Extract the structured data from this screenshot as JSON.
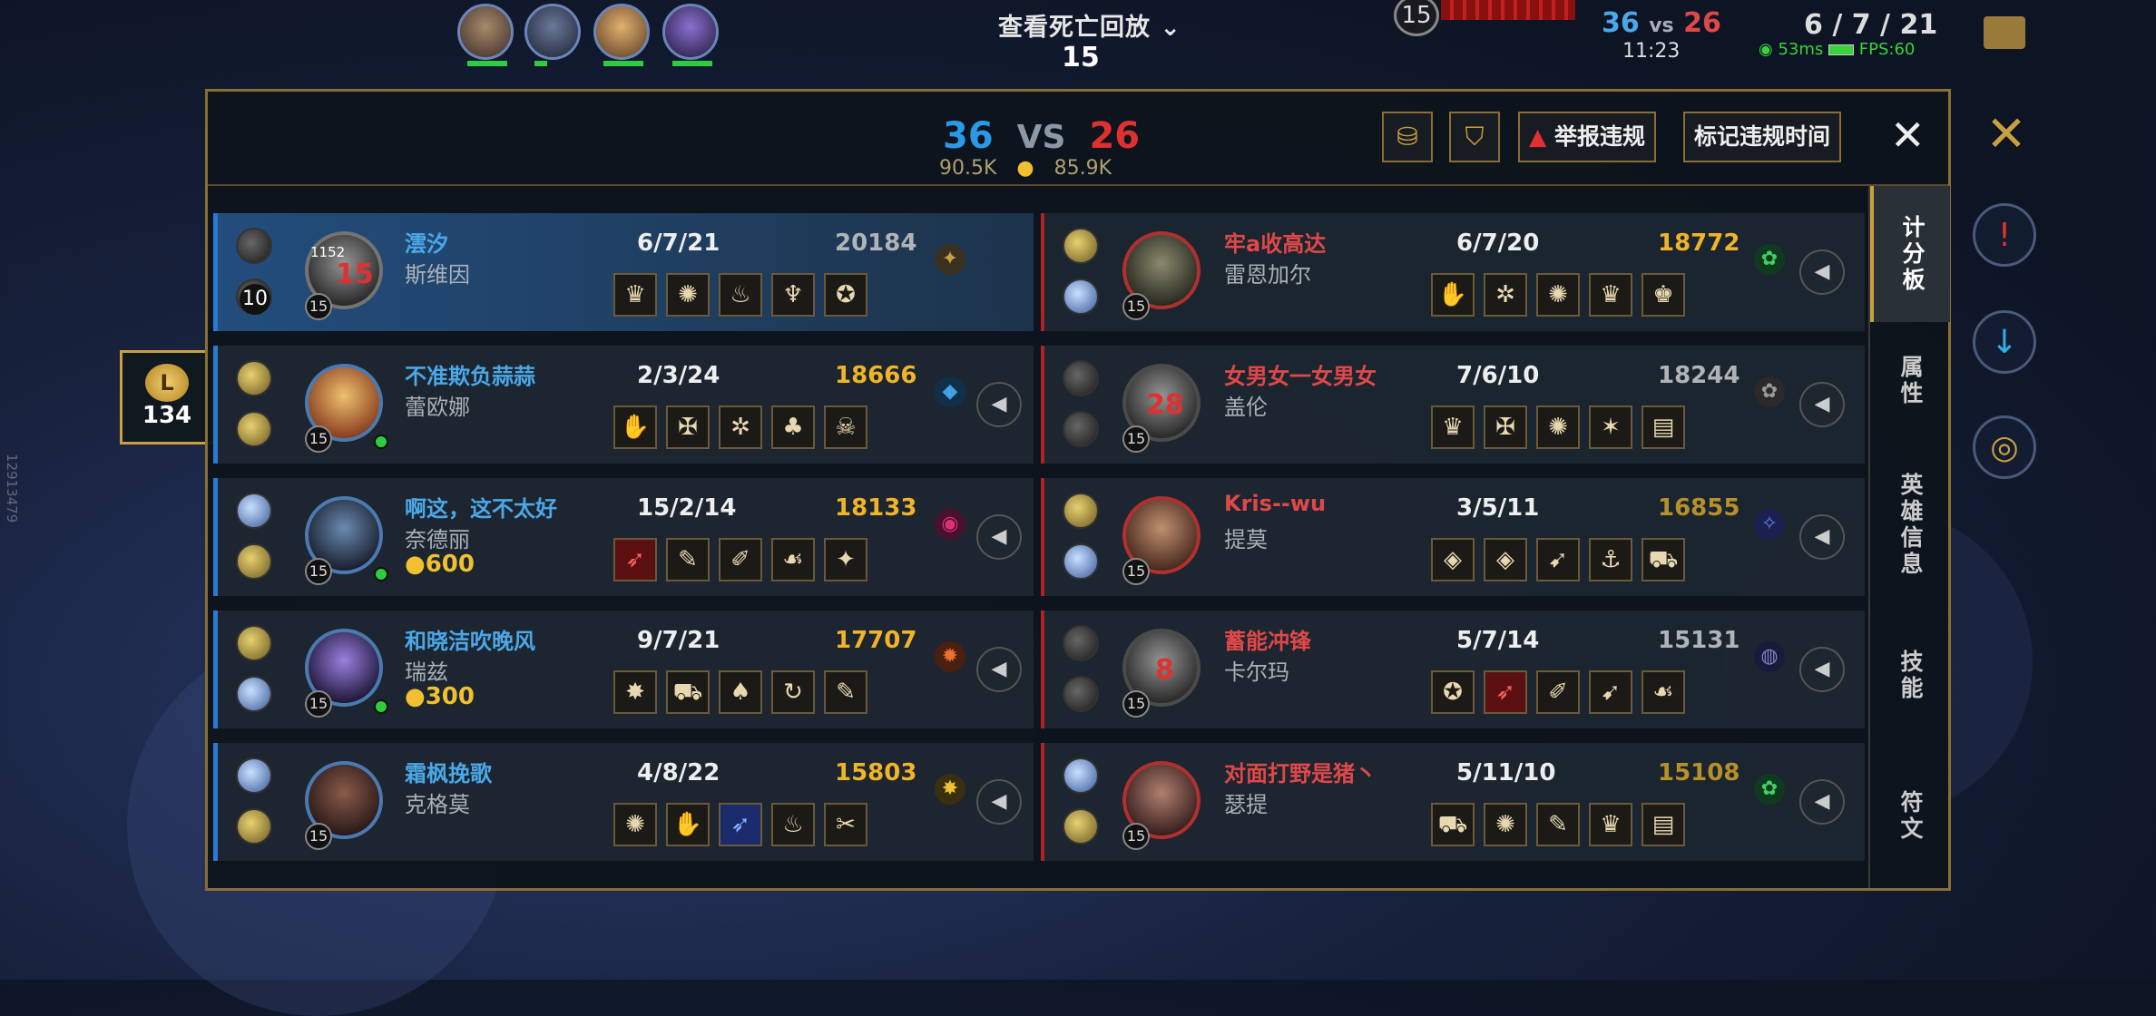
{
  "hud": {
    "death_replay": "查看死亡回放",
    "death_timer": "15",
    "top_level": "15",
    "score_blue": "36",
    "score_vs": "vs",
    "score_red": "26",
    "game_clock": "11:23",
    "my_kda": "6 / 7 / 21",
    "ping": "53ms",
    "fps": "FPS:60",
    "gold": "134",
    "version": "12913479"
  },
  "panel": {
    "blue_kills": "36",
    "vs": "VS",
    "red_kills": "26",
    "blue_gold": "90.5K",
    "red_gold": "85.9K",
    "report_button": "举报违规",
    "mark_button": "标记违规时间",
    "close": "✕"
  },
  "tabs": [
    "计分板",
    "属性",
    "英雄信息",
    "技能",
    "符文"
  ],
  "blue_team": [
    {
      "player": "澐汐",
      "champion": "斯维因",
      "kda": "6/7/21",
      "gold": "20184",
      "level": "15",
      "dead_timer": "15",
      "spell_level": "10",
      "stack": "1152",
      "items": [
        "♛",
        "✺",
        "♨",
        "♆",
        "✪"
      ]
    },
    {
      "player": "不准欺负蒜蒜",
      "champion": "蕾欧娜",
      "kda": "2/3/24",
      "gold": "18666",
      "level": "15",
      "items": [
        "✋",
        "✠",
        "✲",
        "♣",
        "☠"
      ]
    },
    {
      "player": "啊这，这不太好",
      "champion": "奈德丽",
      "kda": "15/2/14",
      "gold": "18133",
      "level": "15",
      "bounty": "600",
      "items": [
        "➶",
        "✎",
        "✐",
        "☙",
        "✦"
      ]
    },
    {
      "player": "和晓洁吹晚风",
      "champion": "瑞兹",
      "kda": "9/7/21",
      "gold": "17707",
      "level": "15",
      "bounty": "300",
      "items": [
        "✸",
        "⛟",
        "♠",
        "↻",
        "✎"
      ]
    },
    {
      "player": "霜枫挽歌",
      "champion": "克格莫",
      "kda": "4/8/22",
      "gold": "15803",
      "level": "15",
      "items": [
        "✺",
        "✋",
        "➶",
        "♨",
        "✂"
      ]
    }
  ],
  "red_team": [
    {
      "player": "牢a收高达",
      "champion": "雷恩加尔",
      "kda": "6/7/20",
      "gold": "18772",
      "level": "15",
      "items": [
        "✋",
        "✲",
        "✺",
        "♛",
        "♚"
      ]
    },
    {
      "player": "女男女一女男女",
      "champion": "盖伦",
      "kda": "7/6/10",
      "gold": "18244",
      "level": "15",
      "dead_timer": "28",
      "items": [
        "♛",
        "✠",
        "✺",
        "✶",
        "▤"
      ]
    },
    {
      "player": "Kris--wu",
      "champion": "提莫",
      "kda": "3/5/11",
      "gold": "16855",
      "level": "15",
      "items": [
        "◈",
        "◈",
        "➹",
        "⚓",
        "⛟"
      ]
    },
    {
      "player": "蓄能冲锋",
      "champion": "卡尔玛",
      "kda": "5/7/14",
      "gold": "15131",
      "level": "15",
      "dead_timer": "8",
      "items": [
        "✪",
        "➶",
        "✐",
        "➹",
        "☙"
      ]
    },
    {
      "player": "对面打野是猪丶",
      "champion": "瑟提",
      "kda": "5/11/10",
      "gold": "15108",
      "level": "15",
      "items": [
        "⛟",
        "✺",
        "✎",
        "♛",
        "▤"
      ]
    }
  ],
  "colors": {
    "blue": "#4aa8e8",
    "red": "#e04848",
    "gold_high": "#f0b428",
    "gold_normal": "#b0b4b8",
    "frame": "#8a6e34"
  }
}
